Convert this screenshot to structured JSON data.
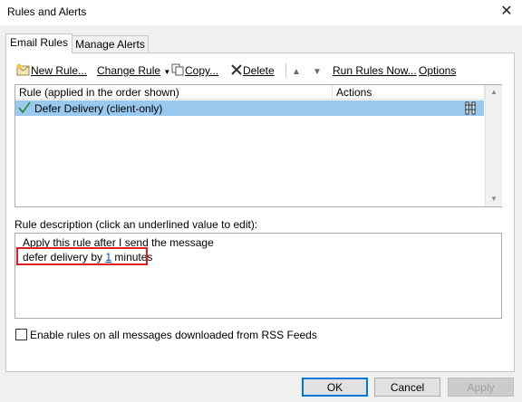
{
  "window": {
    "title": "Rules and Alerts"
  },
  "tabs": [
    {
      "label": "Email Rules"
    },
    {
      "label": "Manage Alerts"
    }
  ],
  "toolbar": {
    "new_rule": "New Rule...",
    "change_rule": "Change Rule",
    "copy": "Copy...",
    "delete": "Delete",
    "run_rules": "Run Rules Now...",
    "options": "Options"
  },
  "rules_list": {
    "headers": {
      "rule": "Rule (applied in the order shown)",
      "actions": "Actions"
    },
    "rows": [
      {
        "name": "Defer Delivery  (client-only)",
        "checked": true,
        "selected": true
      }
    ]
  },
  "description": {
    "label": "Rule description (click an underlined value to edit):",
    "line1": "Apply this rule after I send the message",
    "line2_prefix": "defer delivery by ",
    "line2_value": "1",
    "line2_suffix": " minutes"
  },
  "rss_checkbox": {
    "label": "Enable rules on all messages downloaded from RSS Feeds",
    "checked": false
  },
  "buttons": {
    "ok": "OK",
    "cancel": "Cancel",
    "apply": "Apply"
  },
  "colors": {
    "selection": "#99c9ef",
    "highlight_box": "#e02020",
    "link": "#0645ad",
    "default_button_border": "#0078d7"
  }
}
